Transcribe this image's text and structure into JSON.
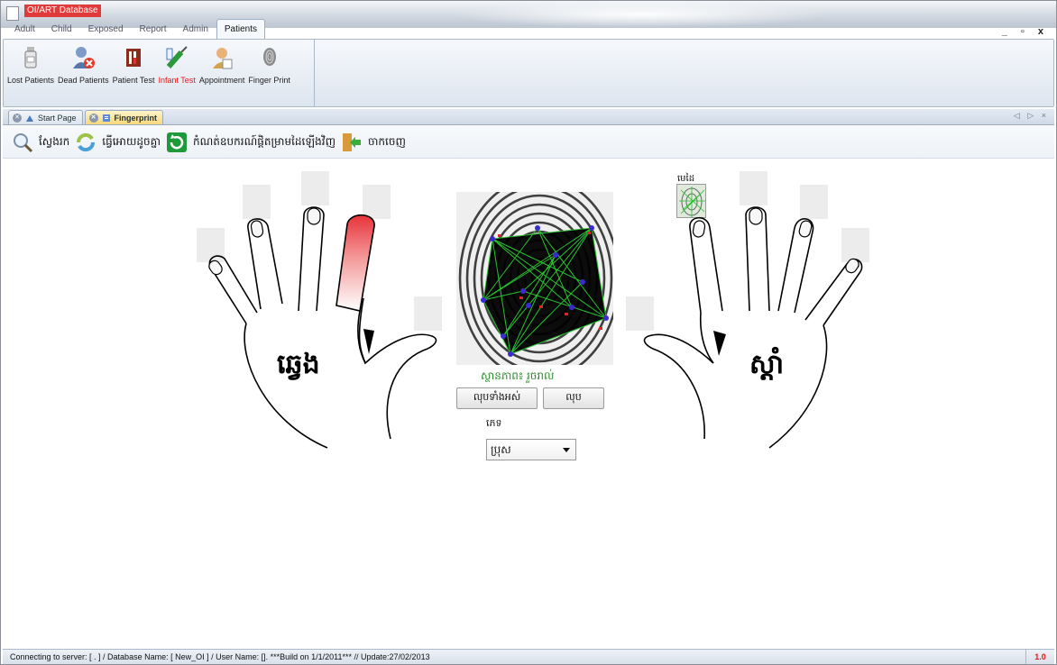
{
  "window": {
    "title": "OI/ART Database",
    "controls": "_ ▫ x"
  },
  "ribbon_tabs": [
    {
      "label": "Adult"
    },
    {
      "label": "Child"
    },
    {
      "label": "Exposed"
    },
    {
      "label": "Report"
    },
    {
      "label": "Admin"
    },
    {
      "label": "Patients"
    }
  ],
  "ribbon_buttons": [
    {
      "label": "Lost Patients",
      "icon": "medicine-bottle-icon"
    },
    {
      "label": "Dead Patients",
      "icon": "user-remove-icon"
    },
    {
      "label": "Patient Test",
      "icon": "test-tube-icon"
    },
    {
      "label": "Infant Test",
      "icon": "syringe-icon",
      "highlight": true
    },
    {
      "label": "Appointment",
      "icon": "appointment-user-icon"
    },
    {
      "label": "Finger Print",
      "icon": "fingerprint-icon"
    }
  ],
  "doc_tabs": [
    {
      "label": "Start Page"
    },
    {
      "label": "Fingerprint"
    }
  ],
  "doc_tab_arrows": "◁ ▷ ×",
  "toolbar": {
    "search": "ស្វែងរក",
    "update": "ធ្វើអោយដូចគ្នា",
    "reset": "កំណត់ឧបករណ៍ផ្តិតម្រាមដៃឡើងវិញ",
    "exit": "ចាកចេញ"
  },
  "main": {
    "left_hand_label": "ឆ្វេង",
    "right_hand_label": "ស្តាំ",
    "status_text": "ស្ថានភាព៖ រួចរាល់",
    "delete_all": "លុបទាំងអស់",
    "delete": "លុប",
    "sex_label": "ភេទ",
    "sex_value": "ប្រុស",
    "thumb_label": "មេដៃ",
    "selected_finger": "left-index"
  },
  "status_bar": {
    "text": "Connecting to server: [ . ] / Database Name: [ New_OI ] / User Name: []. ***Build on 1/1/2011*** // Update:27/02/2013",
    "version": "1.0"
  },
  "colors": {
    "accent_red": "#e01818",
    "status_green": "#2b8a2b",
    "active_tab": "#f7d77a",
    "minutiae_green": "#22c12a",
    "minutiae_point": "#3a2bd0"
  }
}
